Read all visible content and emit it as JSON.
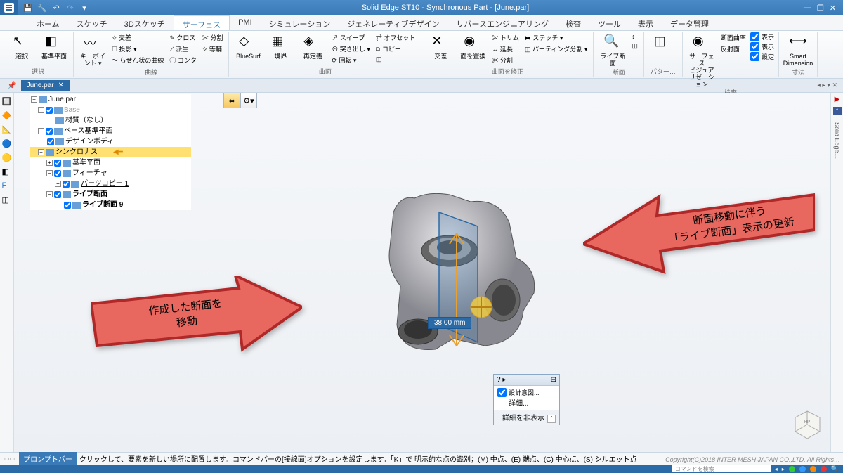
{
  "app": {
    "title": "Solid Edge ST10 - Synchronous Part - [June.par]"
  },
  "qat": {
    "save": "💾",
    "undo": "↶",
    "redo": "↷"
  },
  "tabs": [
    "ホーム",
    "スケッチ",
    "3Dスケッチ",
    "サーフェス",
    "PMI",
    "シミュレーション",
    "ジェネレーティブデザイン",
    "リバースエンジニアリング",
    "検査",
    "ツール",
    "表示",
    "データ管理"
  ],
  "activeTab": 3,
  "win": {
    "min": "—",
    "restore": "❐",
    "close": "✕"
  },
  "ribbon": {
    "groups": [
      {
        "label": "選択",
        "big": [
          {
            "lbl": "選択",
            "icon": "↖"
          },
          {
            "lbl": "基準平面",
            "icon": "◧"
          }
        ]
      },
      {
        "label": "曲線",
        "big": [
          {
            "lbl": "キーポイント ▾",
            "icon": "〰"
          }
        ],
        "small": [
          "✧ 交差",
          "☐ 投影 ▾",
          "〜 らせん状の曲線",
          "✎ クロス",
          "⟋ 派生",
          "◯ コンタ",
          "✂ 分割",
          "✧ 等輔"
        ]
      },
      {
        "label": "曲面",
        "big": [
          {
            "lbl": "BlueSurf",
            "icon": "◇"
          },
          {
            "lbl": "境界",
            "icon": "▦"
          },
          {
            "lbl": "再定義",
            "icon": "◈"
          }
        ],
        "small": [
          "↗ スイープ",
          "⊙ 突き出し ▾",
          "⟳ 回転 ▾",
          "⇄ オフセット",
          "⧉ コピー",
          "◫"
        ]
      },
      {
        "label": "曲面を修正",
        "big": [
          {
            "lbl": "交差",
            "icon": "✕"
          },
          {
            "lbl": "面を置換",
            "icon": "◉"
          }
        ],
        "small": [
          "✂ トリム",
          "↔ 延長",
          "✂ 分割",
          "⧓ ステッチ ▾",
          "◫ パーティング分割 ▾"
        ]
      },
      {
        "label": "断面",
        "big": [
          {
            "lbl": "ライブ断面",
            "icon": "🔍"
          }
        ],
        "small": [
          "↕",
          "◫"
        ]
      },
      {
        "label": "パター…",
        "big": [
          {
            "lbl": "",
            "icon": "◫"
          }
        ]
      },
      {
        "label": "検査",
        "big": [
          {
            "lbl": "サーフェス\\nビジュアリゼーション",
            "icon": "◉"
          }
        ],
        "small2": [
          {
            "l": "断面曲率",
            "c": true,
            "r": "表示"
          },
          {
            "l": "反射面",
            "c": true,
            "r": "表示"
          },
          {
            "l": "",
            "c": true,
            "r": "設定"
          }
        ]
      },
      {
        "label": "寸法",
        "big": [
          {
            "lbl": "Smart\\nDimension",
            "icon": "⟷"
          }
        ]
      }
    ]
  },
  "docTab": "June.par",
  "tree": [
    {
      "ind": 0,
      "exp": "-",
      "chk": null,
      "txt": "June.par"
    },
    {
      "ind": 1,
      "exp": "-",
      "chk": true,
      "txt": "Base",
      "gray": true
    },
    {
      "ind": 2,
      "exp": null,
      "chk": null,
      "txt": "材質（なし）"
    },
    {
      "ind": 1,
      "exp": "+",
      "chk": true,
      "txt": "ベース基準平面"
    },
    {
      "ind": 1,
      "exp": null,
      "chk": true,
      "txt": "デザインボディ"
    },
    {
      "ind": 1,
      "exp": "-",
      "chk": null,
      "txt": "シンクロナス",
      "hl": true,
      "arrow": true
    },
    {
      "ind": 2,
      "exp": "+",
      "chk": true,
      "txt": "基準平面"
    },
    {
      "ind": 2,
      "exp": "-",
      "chk": true,
      "txt": "フィーチャ"
    },
    {
      "ind": 3,
      "exp": "+",
      "chk": true,
      "txt": "パーツコピー 1",
      "ul": true
    },
    {
      "ind": 2,
      "exp": "-",
      "chk": true,
      "txt": "ライブ断面",
      "bold": true
    },
    {
      "ind": 3,
      "exp": null,
      "chk": true,
      "txt": "ライブ断面 9",
      "bold": true
    }
  ],
  "dimension": "38.00 mm",
  "arrowL": "作成した断面を\n移動",
  "arrowR": "断面移動に伴う\n「ライブ断面」表示の更新",
  "panel": {
    "chk": "設計意図...",
    "detail": "詳細...",
    "hide": "詳細を非表示"
  },
  "status": {
    "label": "プロンプトバー",
    "msg": "クリックして、要素を新しい場所に配置します。コマンドバーの[接線面]オプションを設定します。「K」で 明示的な点の識別；(M) 中点、(E) 端点、(C) 中心点、(S) シルエット点"
  },
  "copyright": "Copyright(C)2018 INTER MESH JAPAN CO.,LTD. All Rights…",
  "search": "コマンドを検索"
}
